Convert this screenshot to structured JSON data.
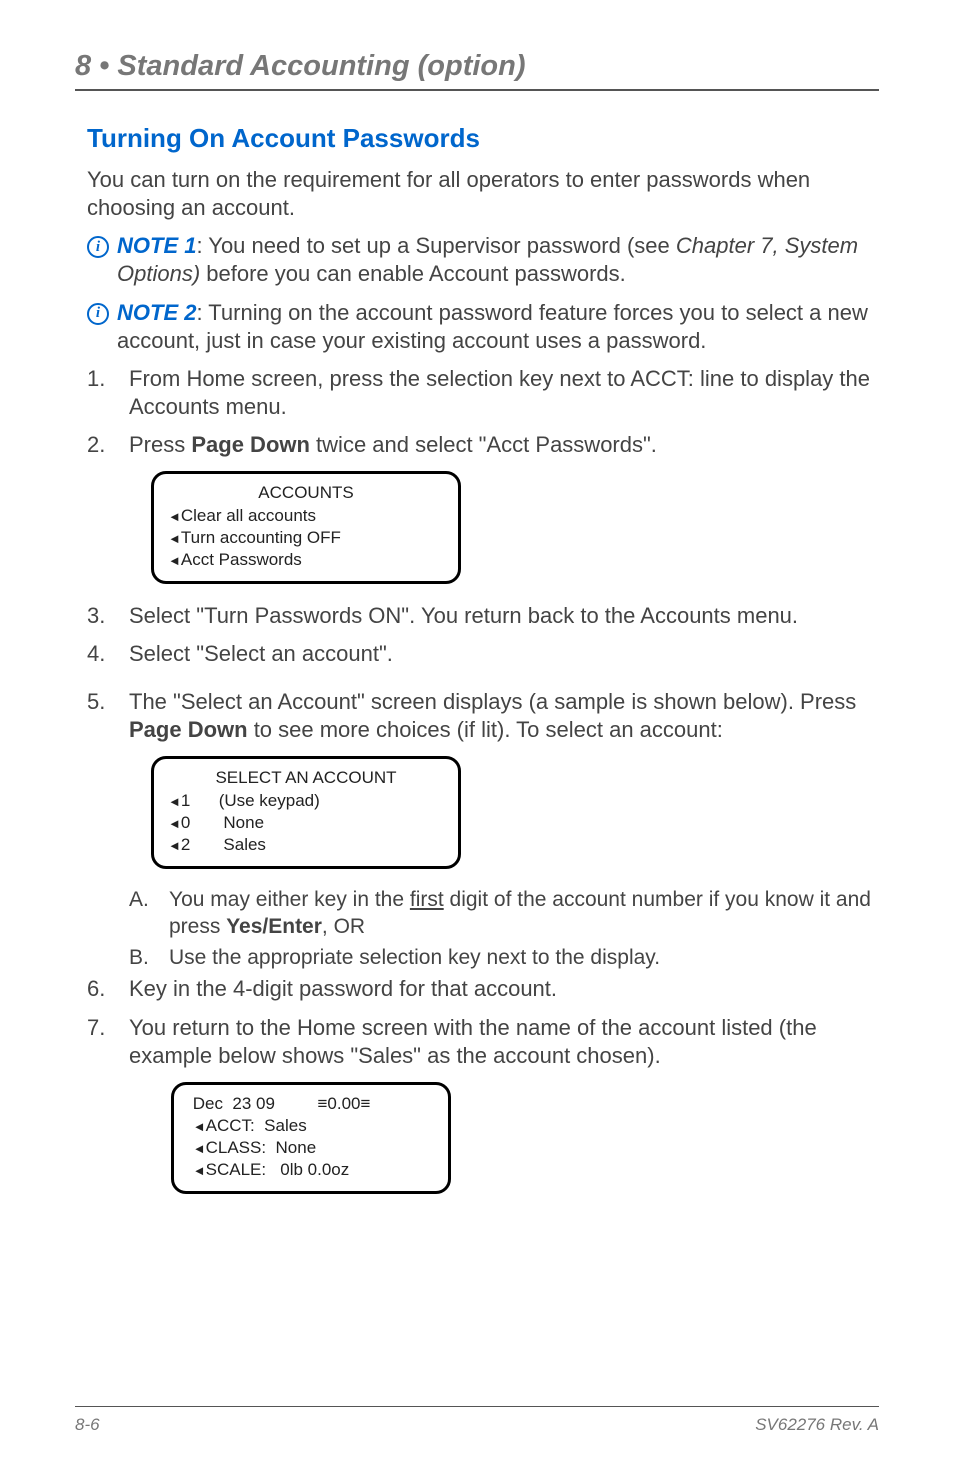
{
  "chapter_header": "8 • Standard Accounting (option)",
  "section_title": "Turning On Account Passwords",
  "intro": "You can turn on the requirement for all operators to enter passwords when choosing an account.",
  "note1": {
    "label": "NOTE 1",
    "before_ref": ": You need to set up a Supervisor password (see ",
    "ref": "Chapter 7, System Options)",
    "after_ref": " before you can enable Account passwords."
  },
  "note2": {
    "label": "NOTE 2",
    "text": ": Turning on the account password feature forces you to select a new account, just in case your existing account uses a password."
  },
  "step1": {
    "num": "1.",
    "text": "From Home screen, press the selection key next to ACCT: line to display the Accounts menu."
  },
  "step2": {
    "num": "2.",
    "prefix": "Press ",
    "bold": "Page Down",
    "suffix": " twice and select \"Acct Passwords\"."
  },
  "screen_accounts": {
    "title": "ACCOUNTS",
    "r1": "Clear all accounts",
    "r2": "Turn accounting OFF",
    "r3": "Acct Passwords"
  },
  "step3": {
    "num": "3.",
    "text": "Select \"Turn Passwords ON\". You return back to the Accounts menu."
  },
  "step4": {
    "num": "4.",
    "text": "Select \"Select an account\"."
  },
  "step5": {
    "num": "5.",
    "prefix": "The \"Select an Account\" screen displays (a sample is shown below). Press ",
    "bold": "Page Down",
    "suffix": " to see more choices (if lit). To select an account:"
  },
  "screen_select": {
    "title": "SELECT AN ACCOUNT",
    "r1_key": "1",
    "r1_val": "(Use keypad)",
    "r2_key": "0",
    "r2_val": "None",
    "r3_key": "2",
    "r3_val": "Sales"
  },
  "sub_a": {
    "let": "A.",
    "p1": "You may either key in the ",
    "u": "first",
    "p2": " digit of the account number if you know it and press ",
    "b": "Yes/Enter",
    "p3": ", OR"
  },
  "sub_b": {
    "let": "B.",
    "text": "Use the appropriate selection key next to the display."
  },
  "step6": {
    "num": "6.",
    "text": "Key in the 4-digit password for that account."
  },
  "step7": {
    "num": "7.",
    "text": "You return to the Home screen with the name of the account listed (the example below shows \"Sales\" as the account chosen)."
  },
  "screen_home": {
    "l1_left": "Dec  23 09",
    "l1_right": "≡0.00≡",
    "l2": "ACCT:  Sales",
    "l3": "CLASS:  None",
    "l4": "SCALE:   0lb 0.0oz"
  },
  "footer_left": "8-6",
  "footer_right": "SV62276 Rev. A"
}
